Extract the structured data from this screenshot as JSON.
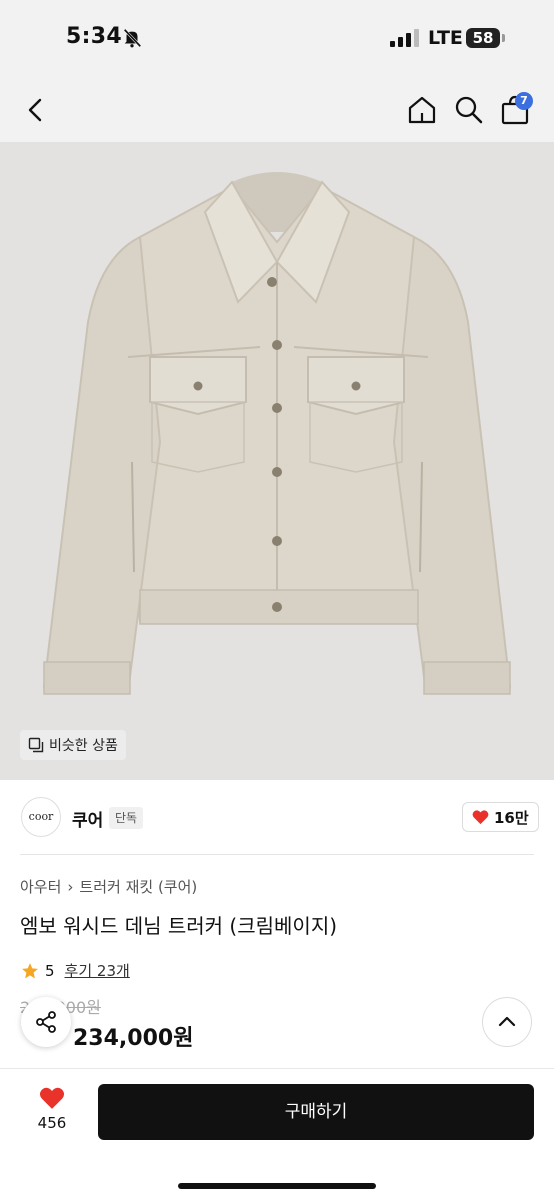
{
  "status_bar": {
    "time": "5:34",
    "network": "LTE",
    "battery": "58"
  },
  "nav": {
    "cart_count": "7"
  },
  "image": {
    "similar_label": "비슷한 상품"
  },
  "brand": {
    "logo_text": "coor",
    "name": "쿠어",
    "badge": "단독",
    "likes": "16만"
  },
  "product": {
    "breadcrumb": [
      "아우터",
      "트러커 재킷 (쿠어)"
    ],
    "title": "엠보 워시드 데님 트러커 (크림베이지)",
    "rating": "5",
    "reviews": "후기 23개",
    "original_price": "234,000원",
    "discount": "",
    "price": "234,000원"
  },
  "bottom": {
    "wish_count": "456",
    "buy_label": "구매하기"
  },
  "colors": {
    "accent_red": "#e8322a",
    "badge_blue": "#3b6fe0",
    "star": "#f5a623"
  }
}
